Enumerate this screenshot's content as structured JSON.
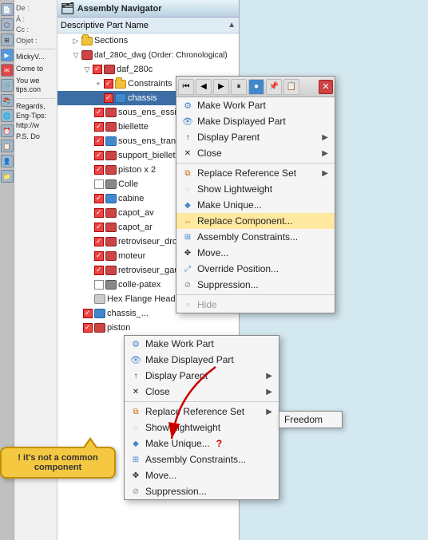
{
  "app": {
    "title": "Assembly Navigator",
    "tree_column": "Descriptive Part Name",
    "sort_dir": "▲"
  },
  "email_panel": {
    "de_label": "De :",
    "a_label": "À :",
    "cc_label": "Cc :",
    "objet_label": "Objet :",
    "sender": "MickyV...",
    "content1": "Come to",
    "content2": "You we tips.con",
    "content3": "Regards, Eng-Tips: http://w",
    "ps": "P.S. Do"
  },
  "tree": {
    "sections_label": "Sections",
    "root_file": "daf_280c_dwg (Order: Chronological)",
    "items": [
      {
        "label": "daf_280c",
        "indent": 2,
        "type": "checked",
        "icon": "part"
      },
      {
        "label": "Constraints",
        "indent": 3,
        "type": "checked",
        "icon": "folder",
        "expand": "+"
      },
      {
        "label": "chassis",
        "indent": 3,
        "type": "checked",
        "icon": "part",
        "selected": true
      },
      {
        "label": "sous_ens_essieu x",
        "indent": 3,
        "type": "checked",
        "icon": "part"
      },
      {
        "label": "biellette",
        "indent": 3,
        "type": "checked",
        "icon": "part"
      },
      {
        "label": "sous_ens_transmi...",
        "indent": 3,
        "type": "checked",
        "icon": "part"
      },
      {
        "label": "support_biellette",
        "indent": 3,
        "type": "checked",
        "icon": "part"
      },
      {
        "label": "piston x 2",
        "indent": 3,
        "type": "checked",
        "icon": "part"
      },
      {
        "label": "Colle",
        "indent": 3,
        "type": "unchecked",
        "icon": "part-gray"
      },
      {
        "label": "cabine",
        "indent": 3,
        "type": "checked",
        "icon": "part"
      },
      {
        "label": "capot_av",
        "indent": 3,
        "type": "checked",
        "icon": "part"
      },
      {
        "label": "capot_ar",
        "indent": 3,
        "type": "checked",
        "icon": "part"
      },
      {
        "label": "retroviseur_droit",
        "indent": 3,
        "type": "checked",
        "icon": "part"
      },
      {
        "label": "moteur",
        "indent": 3,
        "type": "checked",
        "icon": "part"
      },
      {
        "label": "retroviseur_gauch...",
        "indent": 3,
        "type": "checked",
        "icon": "part"
      },
      {
        "label": "colle-patex",
        "indent": 3,
        "type": "unchecked",
        "icon": "part-gray"
      },
      {
        "label": "Hex Flange Head...",
        "indent": 3,
        "type": "part-gray",
        "icon": "part-gray"
      },
      {
        "label": "chassis_...",
        "indent": 2,
        "type": "checked",
        "icon": "part"
      },
      {
        "label": "piston",
        "indent": 2,
        "type": "checked",
        "icon": "part"
      }
    ]
  },
  "context_menu_1": {
    "toolbar_icons": [
      "⏮",
      "▶",
      "⏭",
      "⏸",
      "🔵",
      "📌",
      "📋"
    ],
    "items": [
      {
        "label": "Make Work Part",
        "icon": "wrench",
        "has_arrow": false
      },
      {
        "label": "Make Displayed Part",
        "icon": "display",
        "has_arrow": false
      },
      {
        "label": "Display Parent",
        "icon": "parent",
        "has_arrow": true
      },
      {
        "label": "Close",
        "icon": "close-x",
        "has_arrow": true
      },
      {
        "label": "Replace Reference Set",
        "icon": "ref-set",
        "has_arrow": true
      },
      {
        "label": "Show Lightweight",
        "icon": "lightweight",
        "has_arrow": false
      },
      {
        "label": "Make Unique...",
        "icon": "unique",
        "has_arrow": false
      },
      {
        "label": "Replace Component...",
        "icon": "replace",
        "has_arrow": false,
        "highlighted": true
      },
      {
        "label": "Assembly Constraints...",
        "icon": "constraint",
        "has_arrow": false
      },
      {
        "label": "Move...",
        "icon": "move",
        "has_arrow": false
      },
      {
        "label": "Override Position...",
        "icon": "position",
        "has_arrow": false
      },
      {
        "label": "Suppression...",
        "icon": "suppress",
        "has_arrow": false
      },
      {
        "label": "Hide",
        "icon": "hide",
        "has_arrow": false,
        "disabled": true
      }
    ]
  },
  "context_menu_2": {
    "items": [
      {
        "label": "Make Work Part",
        "icon": "wrench",
        "has_arrow": false
      },
      {
        "label": "Make Displayed Part",
        "icon": "display",
        "has_arrow": false
      },
      {
        "label": "Display Parent",
        "icon": "parent",
        "has_arrow": true
      },
      {
        "label": "Close",
        "icon": "close-x",
        "has_arrow": true
      },
      {
        "label": "Replace Reference Set",
        "icon": "ref-set",
        "has_arrow": true
      },
      {
        "label": "Show Lightweight",
        "icon": "lightweight",
        "has_arrow": false
      },
      {
        "label": "Make Unique...",
        "icon": "unique",
        "has_arrow": false
      },
      {
        "label": "Assembly Constraints...",
        "icon": "constraint",
        "has_arrow": false
      },
      {
        "label": "Move...",
        "icon": "move",
        "has_arrow": false
      },
      {
        "label": "Suppression...",
        "icon": "suppress",
        "has_arrow": false
      }
    ]
  },
  "submenu": {
    "items": [
      {
        "label": "Freedom"
      }
    ]
  },
  "bubble": {
    "text": "! it's not a common component"
  },
  "replace_component_label": "Replace Component \"",
  "question_mark": "?"
}
